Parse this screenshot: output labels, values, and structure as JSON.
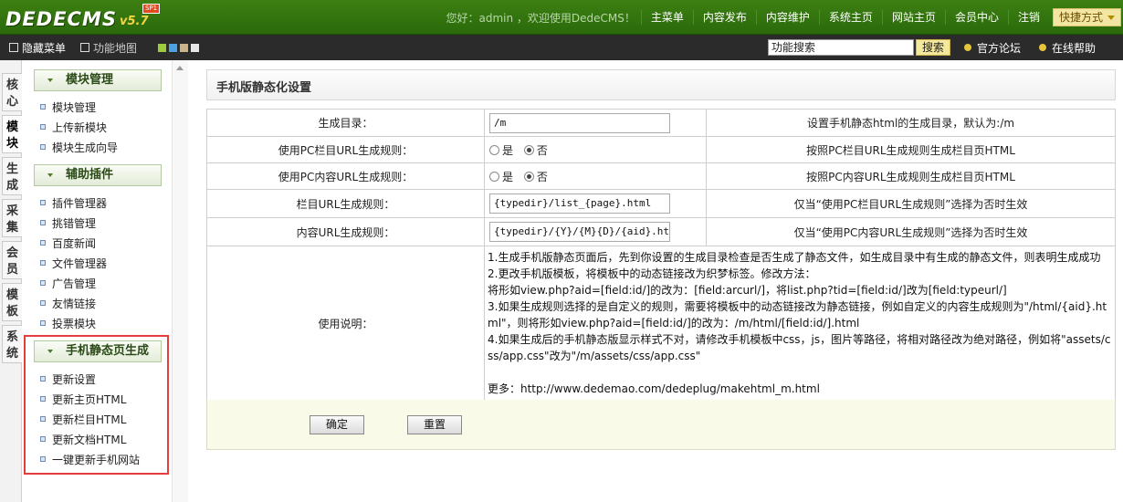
{
  "header": {
    "logo_text": "DEDECMS",
    "logo_version": "v5.7",
    "logo_sp": "SP1",
    "welcome": "您好：admin ，欢迎使用DedeCMS！",
    "nav": [
      "主菜单",
      "内容发布",
      "内容维护",
      "系统主页",
      "网站主页",
      "会员中心",
      "注销"
    ],
    "quick": "快捷方式"
  },
  "subbar": {
    "hide_menu": "隐藏菜单",
    "function_map": "功能地图",
    "search_value": "功能搜索",
    "search_button": "搜索",
    "forum": "官方论坛",
    "help": "在线帮助",
    "swatch_colors": [
      "#9ccc3a",
      "#4aa2e0",
      "#c9b48a",
      "#e8e8e8"
    ]
  },
  "sidetabs": [
    "核心",
    "模块",
    "生成",
    "采集",
    "会员",
    "模板",
    "系统"
  ],
  "menu": {
    "groups": [
      {
        "title": "模块管理",
        "items": [
          "模块管理",
          "上传新模块",
          "模块生成向导"
        ]
      },
      {
        "title": "辅助插件",
        "items": [
          "插件管理器",
          "挑错管理",
          "百度新闻",
          "文件管理器",
          "广告管理",
          "友情链接",
          "投票模块"
        ]
      },
      {
        "title": "手机静态页生成",
        "items": [
          "更新设置",
          "更新主页HTML",
          "更新栏目HTML",
          "更新文档HTML",
          "一键更新手机网站"
        ]
      }
    ]
  },
  "main": {
    "title": "手机版静态化设置",
    "rows": [
      {
        "label": "生成目录：",
        "value": "/m",
        "desc": "设置手机静态html的生成目录，默认为:/m"
      },
      {
        "label": "使用PC栏目URL生成规则：",
        "opt_yes": "是",
        "opt_no": "否",
        "desc": "按照PC栏目URL生成规则生成栏目页HTML"
      },
      {
        "label": "使用PC内容URL生成规则：",
        "opt_yes": "是",
        "opt_no": "否",
        "desc": "按照PC内容URL生成规则生成栏目页HTML"
      },
      {
        "label": "栏目URL生成规则：",
        "value": "{typedir}/list_{page}.html",
        "desc": "仅当“使用PC栏目URL生成规则”选择为否时生效"
      },
      {
        "label": "内容URL生成规则：",
        "value": "{typedir}/{Y}/{M}{D}/{aid}.html",
        "desc": "仅当“使用PC内容URL生成规则”选择为否时生效"
      }
    ],
    "usage_label": "使用说明：",
    "usage": [
      "1.生成手机版静态页面后，先到你设置的生成目录检查是否生成了静态文件，如生成目录中有生成的静态文件，则表明生成成功",
      "2.更改手机版模板，将模板中的动态链接改为织梦标签。修改方法：",
      "将形如view.php?aid=[field:id/]的改为：[field:arcurl/]，将list.php?tid=[field:id/]改为[field:typeurl/]",
      "3.如果生成规则选择的是自定义的规则，需要将模板中的动态链接改为静态链接，例如自定义的内容生成规则为\"/html/{aid}.html\"，则将形如view.php?aid=[field:id/]的改为：/m/html/[field:id/].html",
      "4.如果生成后的手机静态版显示样式不对，请修改手机模板中css，js，图片等路径，将相对路径改为绝对路径，例如将\"assets/css/app.css\"改为\"/m/assets/css/app.css\"",
      "",
      "更多：http://www.dedemao.com/dedeplug/makehtml_m.html"
    ],
    "confirm": "确定",
    "reset": "重置"
  }
}
